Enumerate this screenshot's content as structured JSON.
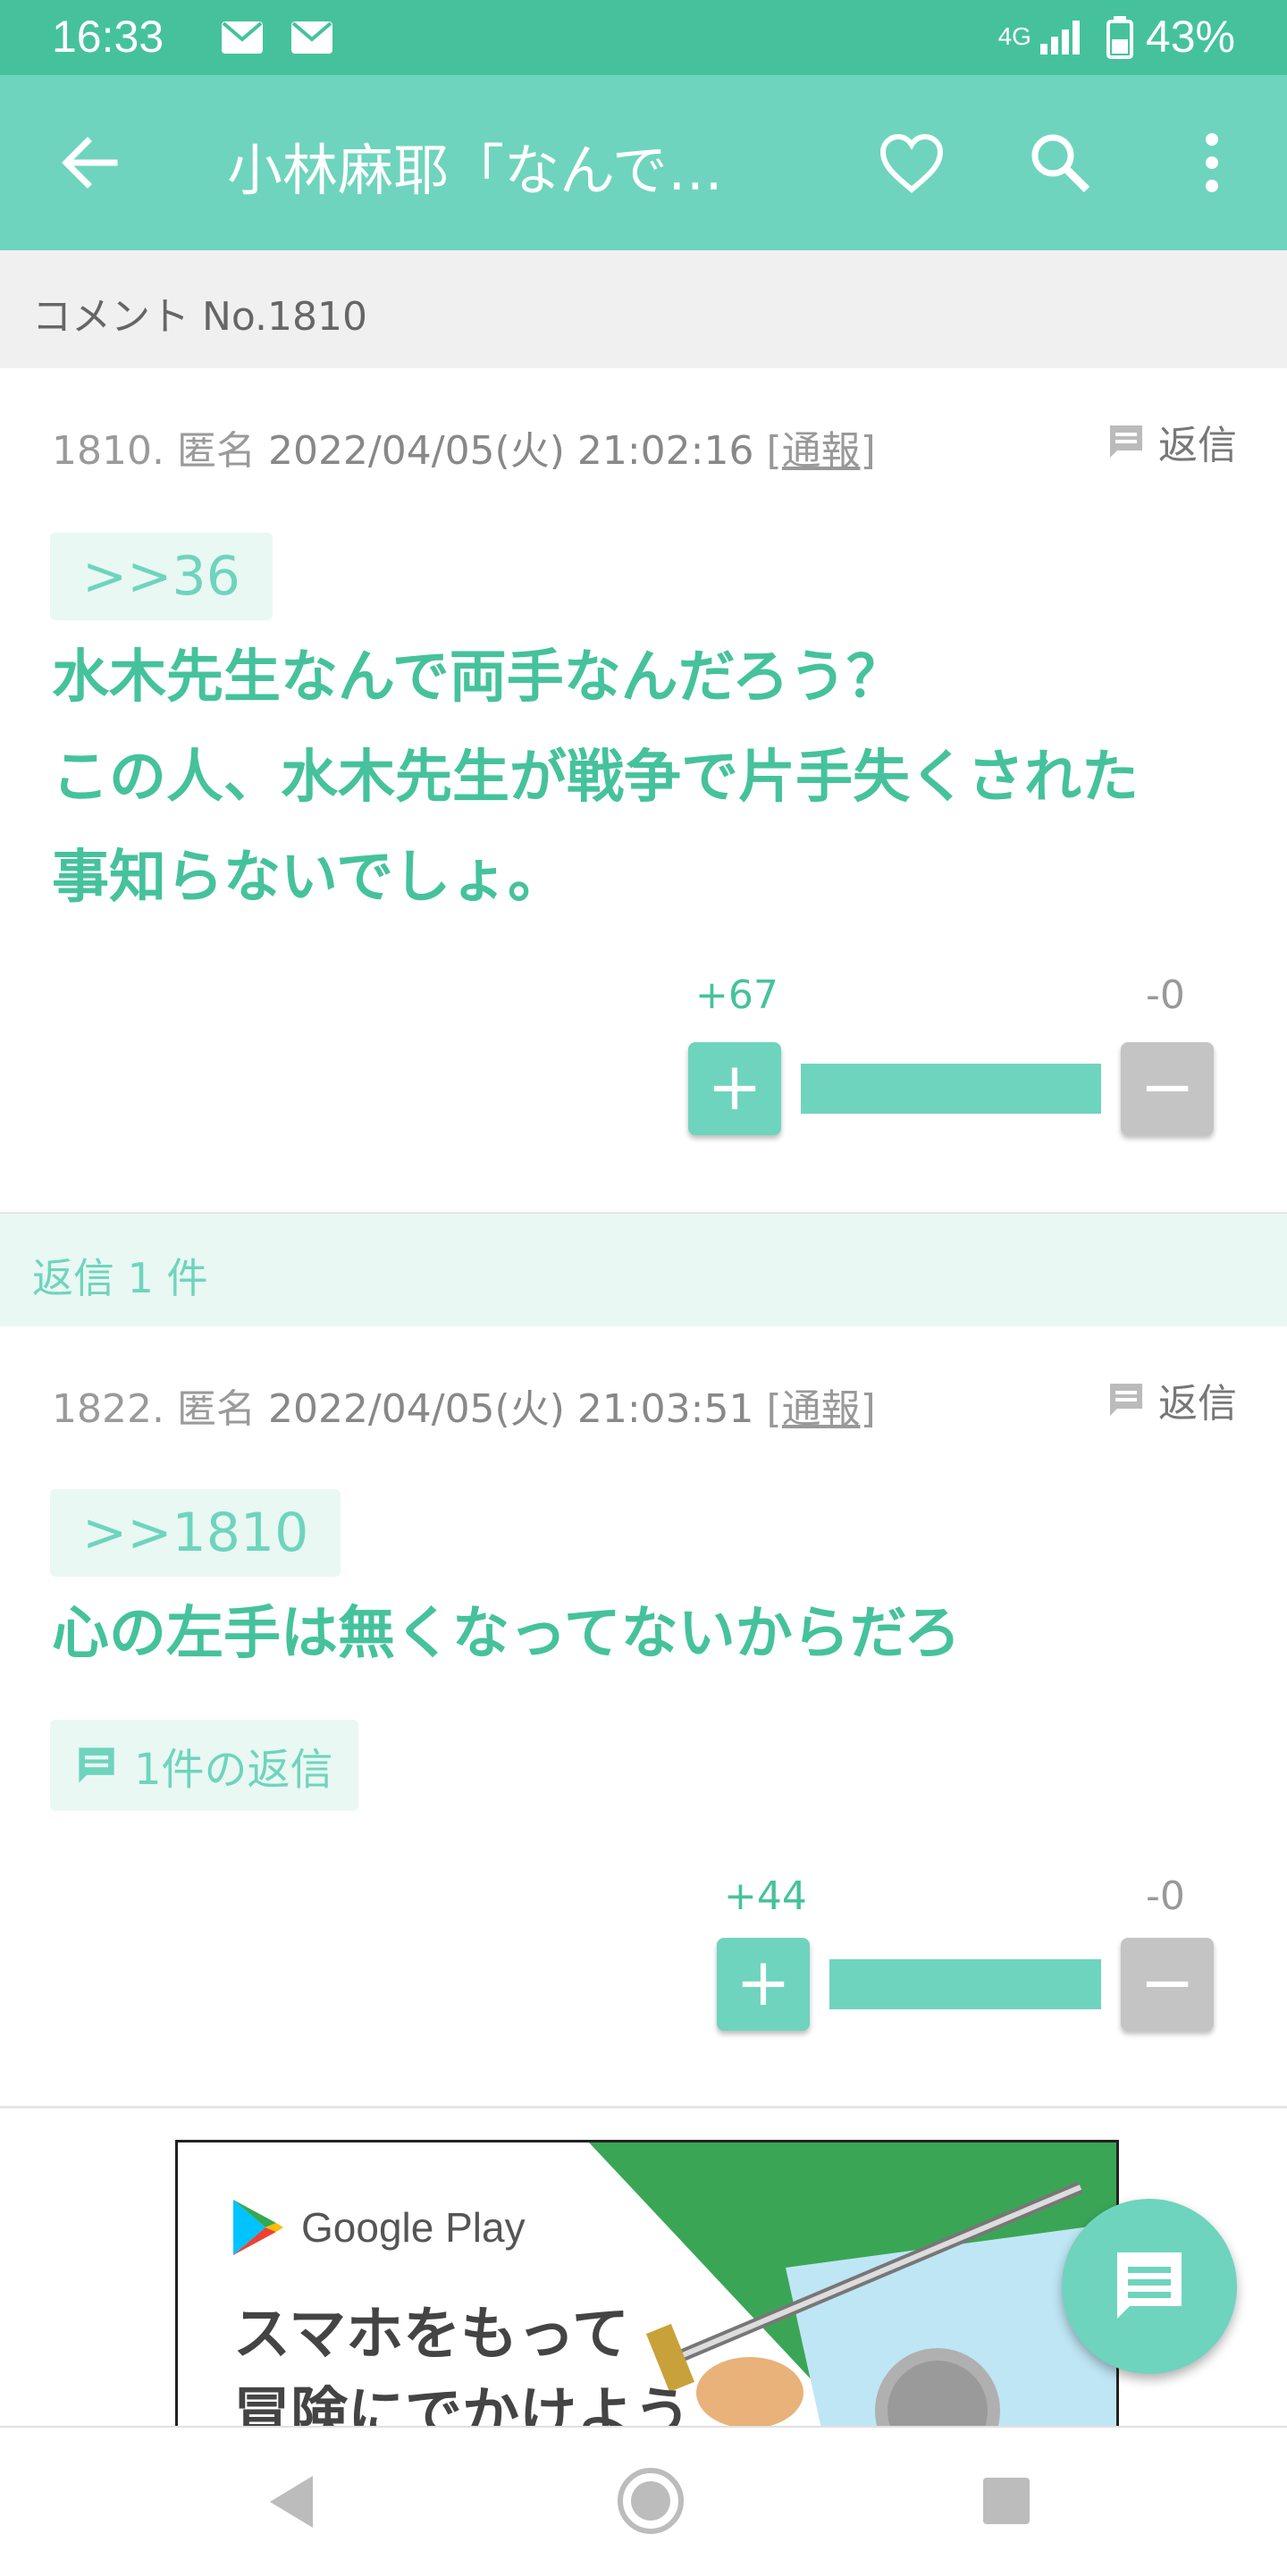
{
  "status": {
    "time": "16:33",
    "network": "4G",
    "battery": "43%"
  },
  "appbar": {
    "title": "小林麻耶「なんで…"
  },
  "section": {
    "header": "コメント No.1810"
  },
  "comments": [
    {
      "meta_no": "1810. 匿名",
      "date": "2022/04/05(火) 21:02:16",
      "report": "[通報]",
      "reply_label": "返信",
      "anchor": ">>36",
      "body": "水木先生なんで両手なんだろう？\nこの人、水木先生が戦争で片手失くされた\n事知らないでしょ。",
      "plus": "+67",
      "minus": "-0",
      "plus_symbol": "+",
      "minus_symbol": "−",
      "good_ratio": 1.0
    },
    {
      "meta_no": "1822. 匿名",
      "date": "2022/04/05(火) 21:03:51",
      "report": "[通報]",
      "reply_label": "返信",
      "anchor": ">>1810",
      "body": "心の左手は無くなってないからだろ",
      "replies_label": "1件の返信",
      "plus": "+44",
      "minus": "-0",
      "plus_symbol": "+",
      "minus_symbol": "−",
      "good_ratio": 1.0
    }
  ],
  "reply_band": {
    "label": "返信 1 件"
  },
  "ad": {
    "store": "Google Play",
    "text": "スマホをもって\n冒険にでかけよう"
  },
  "colors": {
    "accent": "#6fd4bd",
    "accent_dark": "#45c29c",
    "status_bar": "#45c29c"
  }
}
